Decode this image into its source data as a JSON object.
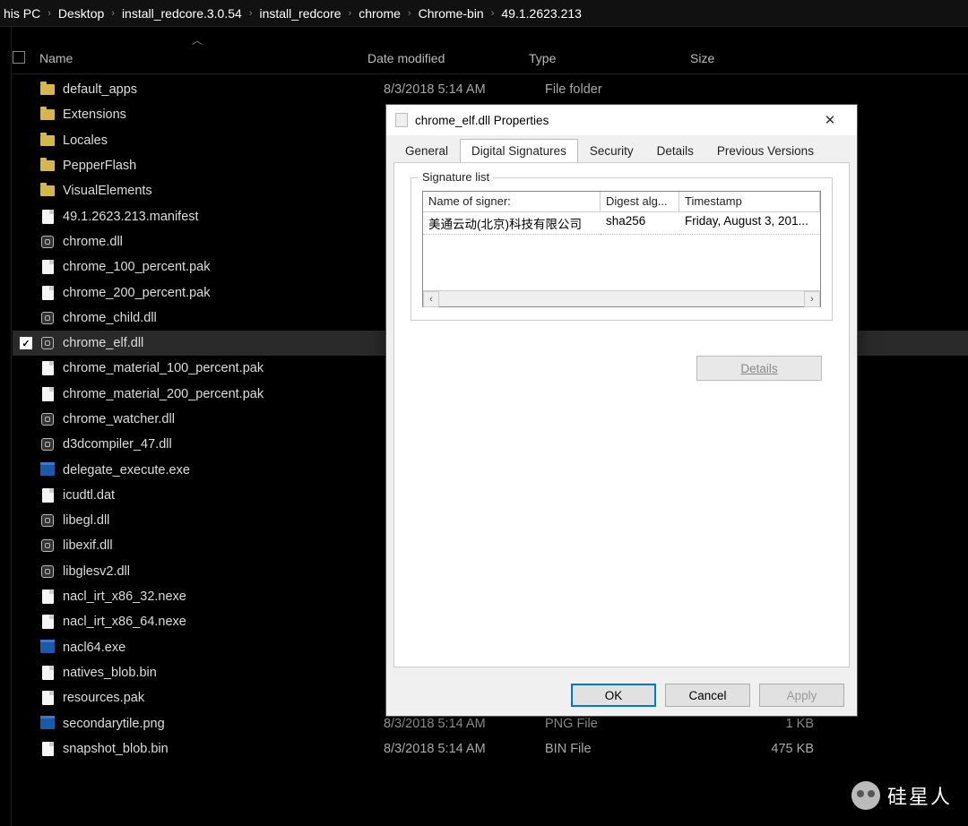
{
  "breadcrumb": [
    "his PC",
    "Desktop",
    "install_redcore.3.0.54",
    "install_redcore",
    "chrome",
    "Chrome-bin",
    "49.1.2623.213"
  ],
  "columns": {
    "name": "Name",
    "date": "Date modified",
    "type": "Type",
    "size": "Size"
  },
  "files": [
    {
      "name": "default_apps",
      "icon": "folder",
      "date": "8/3/2018 5:14 AM",
      "type": "File folder",
      "size": "",
      "selected": false
    },
    {
      "name": "Extensions",
      "icon": "folder",
      "date": "",
      "type": "",
      "size": "",
      "selected": false
    },
    {
      "name": "Locales",
      "icon": "folder",
      "date": "",
      "type": "",
      "size": "",
      "selected": false
    },
    {
      "name": "PepperFlash",
      "icon": "folder",
      "date": "",
      "type": "",
      "size": "",
      "selected": false
    },
    {
      "name": "VisualElements",
      "icon": "folder",
      "date": "",
      "type": "",
      "size": "",
      "selected": false
    },
    {
      "name": "49.1.2623.213.manifest",
      "icon": "file",
      "date": "",
      "type": "",
      "size": "",
      "selected": false
    },
    {
      "name": "chrome.dll",
      "icon": "dll",
      "date": "",
      "type": "",
      "size": "",
      "selected": false
    },
    {
      "name": "chrome_100_percent.pak",
      "icon": "file",
      "date": "",
      "type": "",
      "size": "",
      "selected": false
    },
    {
      "name": "chrome_200_percent.pak",
      "icon": "file",
      "date": "",
      "type": "",
      "size": "",
      "selected": false
    },
    {
      "name": "chrome_child.dll",
      "icon": "dll",
      "date": "",
      "type": "",
      "size": "",
      "selected": false
    },
    {
      "name": "chrome_elf.dll",
      "icon": "dll",
      "date": "",
      "type": "",
      "size": "",
      "selected": true
    },
    {
      "name": "chrome_material_100_percent.pak",
      "icon": "file",
      "date": "",
      "type": "",
      "size": "",
      "selected": false
    },
    {
      "name": "chrome_material_200_percent.pak",
      "icon": "file",
      "date": "",
      "type": "",
      "size": "",
      "selected": false
    },
    {
      "name": "chrome_watcher.dll",
      "icon": "dll",
      "date": "",
      "type": "",
      "size": "",
      "selected": false
    },
    {
      "name": "d3dcompiler_47.dll",
      "icon": "dll",
      "date": "",
      "type": "",
      "size": "",
      "selected": false
    },
    {
      "name": "delegate_execute.exe",
      "icon": "exe",
      "date": "",
      "type": "",
      "size": "",
      "selected": false
    },
    {
      "name": "icudtl.dat",
      "icon": "file",
      "date": "",
      "type": "",
      "size": "",
      "selected": false
    },
    {
      "name": "libegl.dll",
      "icon": "dll",
      "date": "",
      "type": "",
      "size": "",
      "selected": false
    },
    {
      "name": "libexif.dll",
      "icon": "dll",
      "date": "",
      "type": "",
      "size": "",
      "selected": false
    },
    {
      "name": "libglesv2.dll",
      "icon": "dll",
      "date": "",
      "type": "",
      "size": "",
      "selected": false
    },
    {
      "name": "nacl_irt_x86_32.nexe",
      "icon": "file",
      "date": "",
      "type": "",
      "size": "",
      "selected": false
    },
    {
      "name": "nacl_irt_x86_64.nexe",
      "icon": "file",
      "date": "",
      "type": "",
      "size": "",
      "selected": false
    },
    {
      "name": "nacl64.exe",
      "icon": "exe",
      "date": "",
      "type": "",
      "size": "",
      "selected": false
    },
    {
      "name": "natives_blob.bin",
      "icon": "file",
      "date": "",
      "type": "",
      "size": "",
      "selected": false
    },
    {
      "name": "resources.pak",
      "icon": "file",
      "date": "",
      "type": "",
      "size": "",
      "selected": false
    },
    {
      "name": "secondarytile.png",
      "icon": "exe",
      "date": "8/3/2018 5:14 AM",
      "type": "PNG File",
      "size": "1 KB",
      "selected": false
    },
    {
      "name": "snapshot_blob.bin",
      "icon": "file",
      "date": "8/3/2018 5:14 AM",
      "type": "BIN File",
      "size": "475 KB",
      "selected": false
    }
  ],
  "dialog": {
    "title": "chrome_elf.dll Properties",
    "tabs": [
      "General",
      "Digital Signatures",
      "Security",
      "Details",
      "Previous Versions"
    ],
    "active_tab": 1,
    "legend": "Signature list",
    "sig_headers": {
      "signer": "Name of signer:",
      "digest": "Digest alg...",
      "timestamp": "Timestamp"
    },
    "sig_row": {
      "signer": "美通云动(北京)科技有限公司",
      "digest": "sha256",
      "timestamp": "Friday, August 3, 201..."
    },
    "details_btn": "Details",
    "buttons": {
      "ok": "OK",
      "cancel": "Cancel",
      "apply": "Apply"
    }
  },
  "watermark": "硅星人"
}
